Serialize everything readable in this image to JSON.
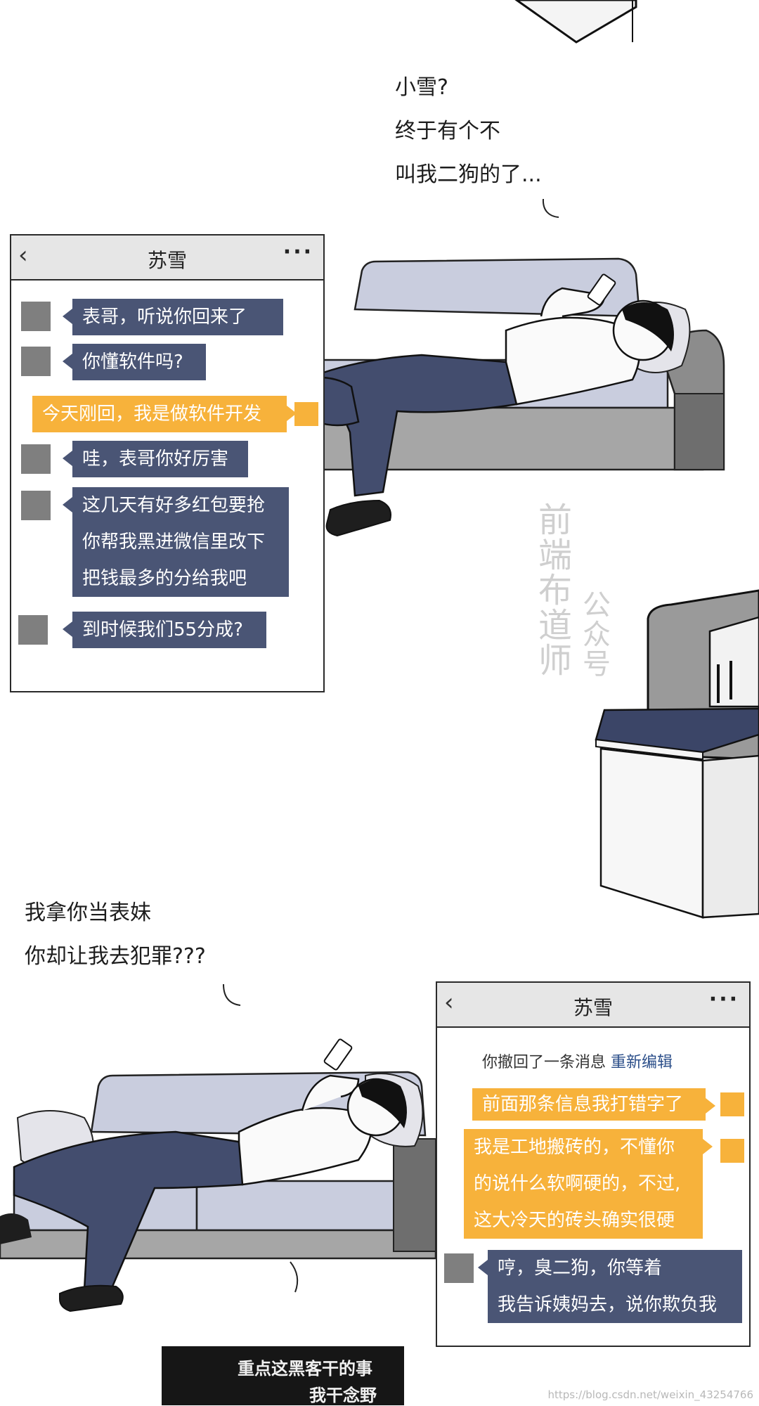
{
  "narration_top": {
    "line1": "小雪?",
    "line2": "终于有个不",
    "line3": "叫我二狗的了..."
  },
  "narration_mid": {
    "line1": "我拿你当表妹",
    "line2": "你却让我去犯罪???"
  },
  "watermark": {
    "main": "前端布道师",
    "sub": "公众号"
  },
  "chat1": {
    "back_icon": "chevron-left-icon",
    "title": "苏雪",
    "more": "···",
    "messages": [
      {
        "from": "them",
        "text": "表哥，听说你回来了"
      },
      {
        "from": "them",
        "text": "你懂软件吗?"
      },
      {
        "from": "me",
        "text": "今天刚回，我是做软件开发"
      },
      {
        "from": "them",
        "text": "哇，表哥你好厉害"
      },
      {
        "from": "them",
        "lines": [
          "这几天有好多红包要抢",
          "你帮我黑进微信里改下",
          "把钱最多的分给我吧"
        ]
      },
      {
        "from": "them",
        "text": "到时候我们55分成?"
      }
    ]
  },
  "chat2": {
    "back_icon": "chevron-left-icon",
    "title": "苏雪",
    "more": "···",
    "recall_notice": "你撤回了一条消息",
    "recall_link": "重新编辑",
    "messages": [
      {
        "from": "me",
        "text": "前面那条信息我打错字了"
      },
      {
        "from": "me",
        "lines": [
          "我是工地搬砖的，不懂你",
          "的说什么软啊硬的，不过,",
          "这大冷天的砖头确实很硬"
        ]
      },
      {
        "from": "them",
        "lines": [
          "哼，臭二狗，你等着",
          "我告诉姨妈去，说你欺负我"
        ]
      }
    ]
  },
  "banner": {
    "line1": "重点这黑客干的事",
    "line2": "我干念野"
  },
  "footer": {
    "url": "https://blog.csdn.net/weixin_43254766"
  },
  "colors": {
    "them_bubble": "#4a5575",
    "me_bubble": "#f7b23b",
    "avatar_gray": "#7f7f7f",
    "sofa": "#c9cdde",
    "jeans": "#434d6e"
  }
}
